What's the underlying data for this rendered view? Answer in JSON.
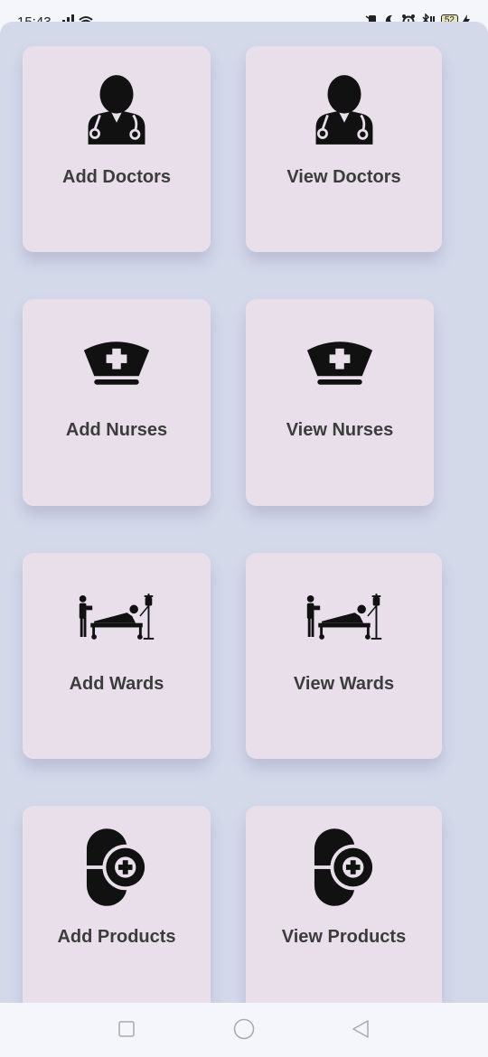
{
  "status_bar": {
    "time": "15:43",
    "battery": "52",
    "icons": [
      "signal-icon",
      "wifi-icon",
      "vibrate-icon",
      "moon-icon",
      "alarm-icon",
      "bluetooth-icon",
      "battery-icon",
      "charging-icon"
    ]
  },
  "grid": {
    "cards": [
      {
        "label": "Add Doctors",
        "icon": "doctor-icon"
      },
      {
        "label": "View Doctors",
        "icon": "doctor-icon"
      },
      {
        "label": "Add Nurses",
        "icon": "nurse-cap-icon"
      },
      {
        "label": "View Nurses",
        "icon": "nurse-cap-icon"
      },
      {
        "label": "Add Wards",
        "icon": "hospital-bed-icon"
      },
      {
        "label": "View Wards",
        "icon": "hospital-bed-icon"
      },
      {
        "label": "Add Products",
        "icon": "medicine-add-icon"
      },
      {
        "label": "View Products",
        "icon": "medicine-add-icon"
      }
    ]
  },
  "nav_bar": {
    "icons": [
      "recents-square-icon",
      "home-circle-icon",
      "back-triangle-icon"
    ]
  },
  "colors": {
    "background": "#d4d9ea",
    "card": "#e8dfeb",
    "label": "#3c3c3c"
  }
}
